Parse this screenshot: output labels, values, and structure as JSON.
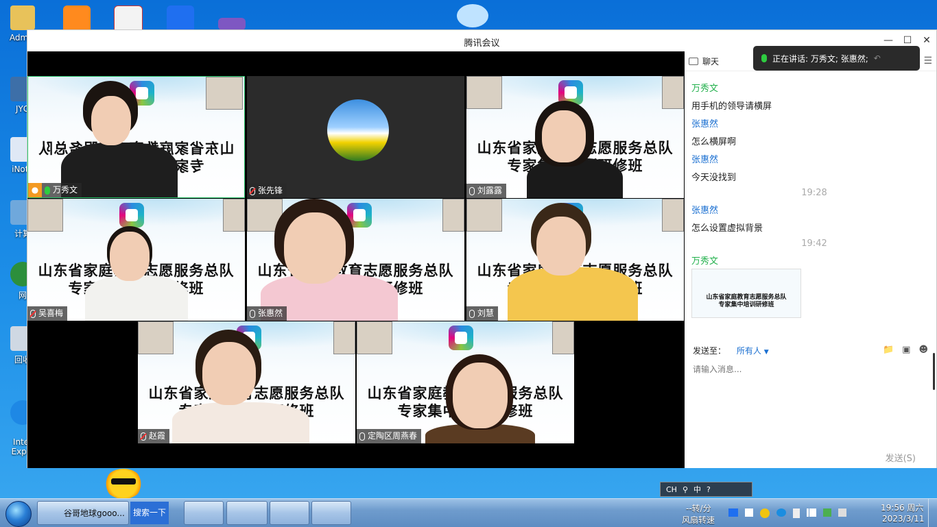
{
  "desktop": {
    "icons": [
      {
        "label": "Admin"
      },
      {
        "label": "JYG"
      },
      {
        "label": "iNote"
      },
      {
        "label": "计算"
      },
      {
        "label": "网"
      },
      {
        "label": "回收"
      },
      {
        "label": "Inter\nExplo"
      }
    ]
  },
  "window": {
    "title": "腾讯会议",
    "controls": {
      "minimize": "—",
      "maximize": "☐",
      "close": "✕"
    }
  },
  "tiles": [
    {
      "name": "万秀文",
      "banner": "山东省家庭教育志愿服务总队\n专家集中培训研修班",
      "mirrored": true,
      "active": true,
      "host": true
    },
    {
      "name": "张先锋",
      "avatar": true
    },
    {
      "name": "刘露露",
      "banner": "山东省家庭教育志愿服务总队\n专家集中培训研修班"
    },
    {
      "name": "吴喜梅",
      "banner": "山东省家庭教育志愿服务总队\n专家集中培训研修班"
    },
    {
      "name": "张惠然",
      "banner": "山东省家庭教育志愿服务总队\n专家集中培训研修班"
    },
    {
      "name": "刘慧",
      "banner": "山东省家庭教育志愿服务总队\n专家集中培训研修班"
    },
    {
      "name": "赵霞",
      "banner": "山东省家庭教育志愿服务总队\n专家集中培训研修班"
    },
    {
      "name": "定陶区周燕春",
      "banner": "山东省家庭教育志愿服务总队\n专家集中培训研修班"
    }
  ],
  "chat": {
    "header": "聊天",
    "speaking": "正在讲话: 万秀文; 张惠然;",
    "messages": [
      {
        "sender": "万秀文",
        "text": "用手机的领导请横屏",
        "sender_color": "#21b04b"
      },
      {
        "sender": "张惠然",
        "text": "怎么横屏啊",
        "sender_color": "#1a6fd1"
      },
      {
        "sender": "张惠然",
        "text": "今天没找到",
        "sender_color": "#1a6fd1"
      },
      {
        "time": "19:28"
      },
      {
        "sender": "张惠然",
        "text": "怎么设置虚拟背景",
        "sender_color": "#1a6fd1"
      },
      {
        "time": "19:42"
      },
      {
        "sender": "万秀文",
        "image_caption": "山东省家庭教育志愿服务总队\n专家集中培训研修班",
        "sender_color": "#21b04b"
      }
    ],
    "send_to_label": "发送至：",
    "send_to_value": "所有人",
    "input_placeholder": "请输入消息...",
    "send_button": "发送(S)"
  },
  "taskbar": {
    "ie_label": "谷哥地球gooo...",
    "search_label": "搜索一下",
    "net_speed": "--转/分",
    "fan_label": "风扇转速",
    "time": "19:56 周六",
    "date": "2023/3/11",
    "ime": {
      "lang": "CH",
      "mode": "中"
    }
  }
}
